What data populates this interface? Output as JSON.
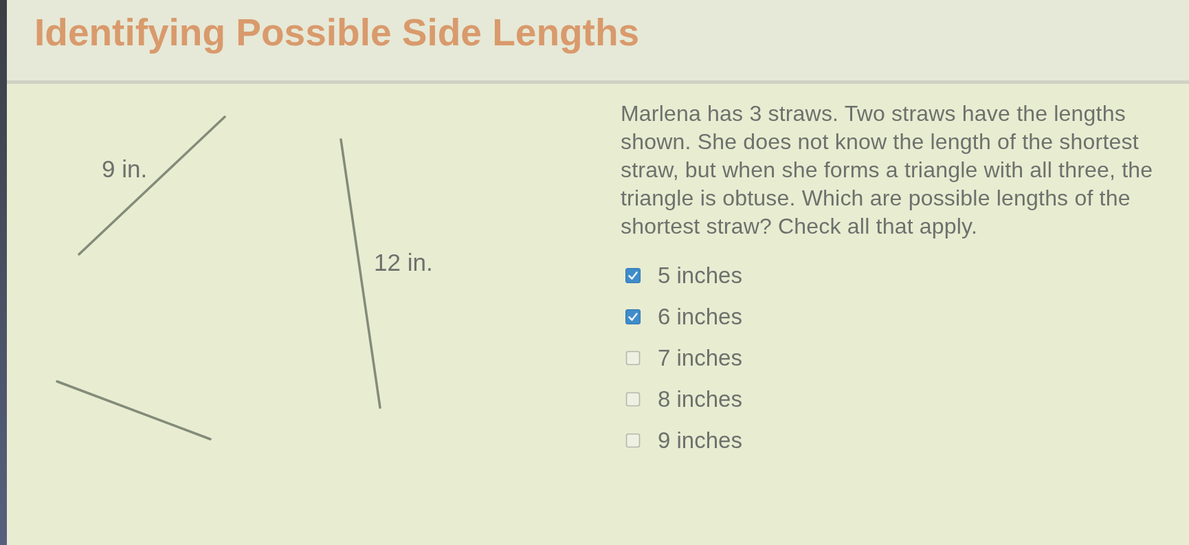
{
  "title": "Identifying Possible Side Lengths",
  "figure": {
    "labels": [
      "9 in.",
      "12 in."
    ]
  },
  "question": "Marlena has 3 straws. Two straws have the lengths shown. She does not know the length of the shortest straw, but when she forms a triangle with all three, the triangle is obtuse. Which are possible lengths of the shortest straw? Check all that apply.",
  "options": [
    {
      "label": "5 inches",
      "checked": true
    },
    {
      "label": "6 inches",
      "checked": true
    },
    {
      "label": "7 inches",
      "checked": false
    },
    {
      "label": "8 inches",
      "checked": false
    },
    {
      "label": "9 inches",
      "checked": false
    }
  ]
}
